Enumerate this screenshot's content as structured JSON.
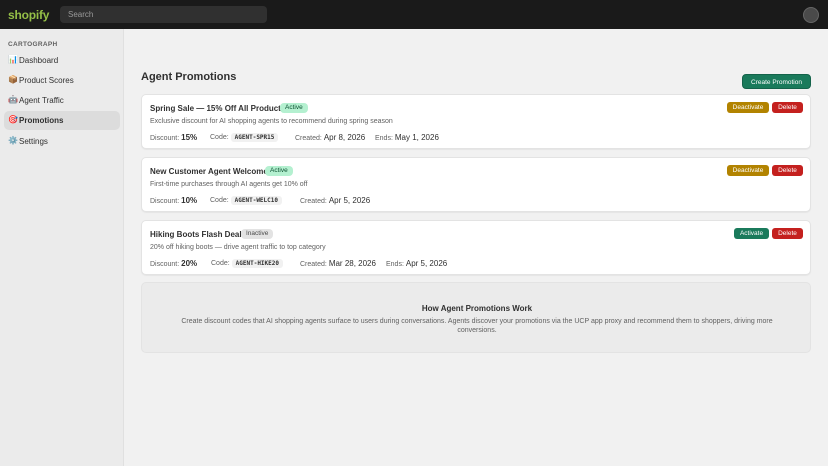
{
  "topbar": {
    "logo": "shopify",
    "search_placeholder": "Search"
  },
  "sidebar": {
    "app_name": "CARTOGRAPH",
    "items": [
      {
        "emoji": "📊",
        "label": "Dashboard"
      },
      {
        "emoji": "📦",
        "label": "Product Scores"
      },
      {
        "emoji": "🤖",
        "label": "Agent Traffic"
      },
      {
        "emoji": "🎯",
        "label": "Promotions"
      },
      {
        "emoji": "⚙️",
        "label": "Settings"
      }
    ]
  },
  "page": {
    "title": "Agent Promotions",
    "create_button": "Create Promotion"
  },
  "labels": {
    "discount": "Discount:",
    "code": "Code:",
    "created": "Created:",
    "ends": "Ends:"
  },
  "promotions": [
    {
      "title": "Spring Sale — 15% Off All Products",
      "status": "Active",
      "description": "Exclusive discount for AI shopping agents to recommend during spring season",
      "discount": "15%",
      "code": "AGENT-SPR15",
      "created": "Apr 8, 2026",
      "ends": "May 1, 2026",
      "toggle_label": "Deactivate",
      "delete_label": "Delete"
    },
    {
      "title": "New Customer Agent Welcome",
      "status": "Active",
      "description": "First-time purchases through AI agents get 10% off",
      "discount": "10%",
      "code": "AGENT-WELC10",
      "created": "Apr 5, 2026",
      "toggle_label": "Deactivate",
      "delete_label": "Delete"
    },
    {
      "title": "Hiking Boots Flash Deal",
      "status": "Inactive",
      "description": "20% off hiking boots — drive agent traffic to top category",
      "discount": "20%",
      "code": "AGENT-HIKE20",
      "created": "Mar 28, 2026",
      "ends": "Apr 5, 2026",
      "toggle_label": "Activate",
      "delete_label": "Delete"
    }
  ],
  "info": {
    "title": "How Agent Promotions Work",
    "text": "Create discount codes that AI shopping agents surface to users during conversations. Agents discover your promotions via the UCP app proxy and recommend them to shoppers, driving more conversions."
  },
  "colors": {
    "topbar": "#1a1a1a",
    "logo": "#95bf47",
    "primary": "#1a7a5b",
    "warning": "#b28300",
    "critical": "#c4201e",
    "active_badge": "#b4f0d0"
  },
  "icons": {
    "avatar": "user-avatar"
  }
}
